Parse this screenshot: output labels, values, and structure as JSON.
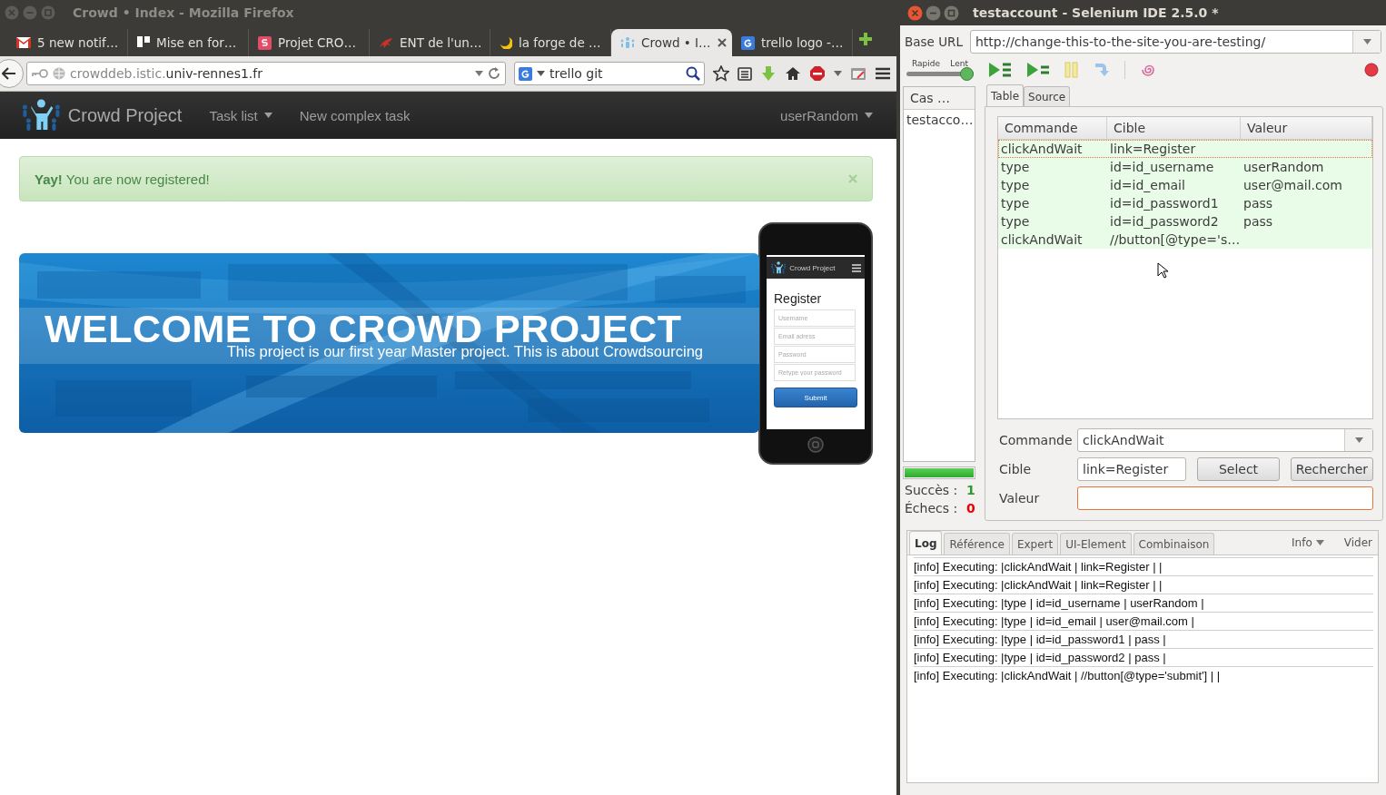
{
  "browser": {
    "title": "Crowd • Index - Mozilla Firefox",
    "tabs": [
      {
        "label": "5 new notif…",
        "kind": "mail",
        "selected": false
      },
      {
        "label": "Mise en for…",
        "kind": "board",
        "selected": false
      },
      {
        "label": "Projet CRO…",
        "kind": "app",
        "selected": false
      },
      {
        "label": "ENT de l'un…",
        "kind": "bug",
        "selected": false
      },
      {
        "label": "la forge de …",
        "kind": "moon",
        "selected": false
      },
      {
        "label": "Crowd • I…",
        "kind": "crowd",
        "selected": true
      },
      {
        "label": "trello logo -…",
        "kind": "engine",
        "selected": false
      }
    ],
    "url": {
      "subdomain": "crowddeb.istic.",
      "domain": "univ-rennes1.fr"
    },
    "search": {
      "value": "trello git"
    }
  },
  "site": {
    "brand": "Crowd Project",
    "nav": [
      {
        "label": "Task list",
        "dropdown": true
      },
      {
        "label": "New complex task",
        "dropdown": false
      }
    ],
    "user": {
      "label": "userRandom",
      "dropdown": true
    },
    "alert": {
      "text": "**Yay!** You are now registered!"
    },
    "banner": {
      "heading": "WELCOME TO CROWD PROJECT",
      "subtitle": "This project is our first year Master project. This is about Crowdsourcing"
    },
    "phone": {
      "brand": "Crowd Project",
      "heading": "Register",
      "fields": [
        {
          "placeholder": "Username"
        },
        {
          "placeholder": "Email adress"
        },
        {
          "placeholder": "Password"
        },
        {
          "placeholder": "Retype your password"
        }
      ],
      "button": "Submit"
    }
  },
  "selenium": {
    "title": "testaccount - Selenium IDE 2.5.0 *",
    "base_url": {
      "label": "Base URL",
      "value": "http://change-this-to-the-site-you-are-testing/"
    },
    "speed": {
      "fast": "Rapide",
      "slow": "Lent",
      "level": 1
    },
    "test_cases": {
      "header": "Cas …",
      "items": [
        {
          "label": "testacco…",
          "selected": false
        }
      ]
    },
    "progress": {
      "level": 1
    },
    "runs": {
      "success_label": "Succès :",
      "success": "1",
      "failure_label": "Échecs :",
      "failures": "0"
    },
    "view_tabs": [
      {
        "label": "Table",
        "selected": true
      },
      {
        "label": "Source",
        "selected": false
      }
    ],
    "table": {
      "columns": [
        "Commande",
        "Cible",
        "Valeur"
      ],
      "rows": [
        {
          "cells": [
            "clickAndWait",
            "link=Register",
            ""
          ],
          "selected": true,
          "passed": true
        },
        {
          "cells": [
            "type",
            "id=id_username",
            "userRandom"
          ],
          "selected": false,
          "passed": true
        },
        {
          "cells": [
            "type",
            "id=id_email",
            "user@mail.com"
          ],
          "selected": false,
          "passed": true
        },
        {
          "cells": [
            "type",
            "id=id_password1",
            "pass"
          ],
          "selected": false,
          "passed": true
        },
        {
          "cells": [
            "type",
            "id=id_password2",
            "pass"
          ],
          "selected": false,
          "passed": true
        },
        {
          "cells": [
            "clickAndWait",
            "//button[@type='s…",
            ""
          ],
          "selected": false,
          "passed": true
        }
      ]
    },
    "editor": {
      "command_label": "Commande",
      "command": "clickAndWait",
      "target_label": "Cible",
      "target": "link=Register",
      "select": "Select",
      "find": "Rechercher",
      "value_label": "Valeur",
      "value_focused": true
    },
    "log_tabs": [
      {
        "label": "Log",
        "selected": true
      },
      {
        "label": "Référence",
        "selected": false
      },
      {
        "label": "Expert",
        "selected": false
      },
      {
        "label": "UI-Element",
        "selected": false
      },
      {
        "label": "Combinaison",
        "selected": false
      }
    ],
    "log_level": "Info",
    "clear": "Vider",
    "log": [
      "[info] Executing: |clickAndWait | link=Register | |",
      "[info] Executing: |clickAndWait | link=Register | |",
      "[info] Executing: |type | id=id_username | userRandom |",
      "[info] Executing: |type | id=id_email | user@mail.com |",
      "[info] Executing: |type | id=id_password1 | pass |",
      "[info] Executing: |type | id=id_password2 | pass |",
      "[info] Executing: |clickAndWait | //button[@type='submit'] | |"
    ]
  }
}
